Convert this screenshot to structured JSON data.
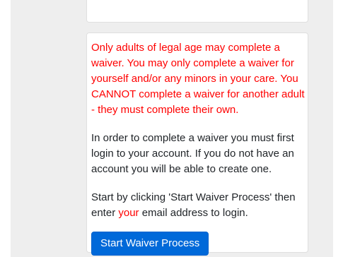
{
  "warning": {
    "text": "Only adults of legal age may complete a waiver. You may only complete a waiver for yourself and/or any minors in your care. You CANNOT complete a waiver for another adult - they must complete their own."
  },
  "login_info": {
    "text": "In order to complete a waiver you must first login to your account. If you do not have an account you will be able to create one."
  },
  "instructions": {
    "before": "Start by clicking 'Start Waiver Process' then enter ",
    "highlight": "your",
    "after": " email address to login."
  },
  "start_button": {
    "label": "Start Waiver Process"
  },
  "colors": {
    "warning": "#ff0000",
    "primary": "#0069d9",
    "background": "#eeeeee"
  }
}
